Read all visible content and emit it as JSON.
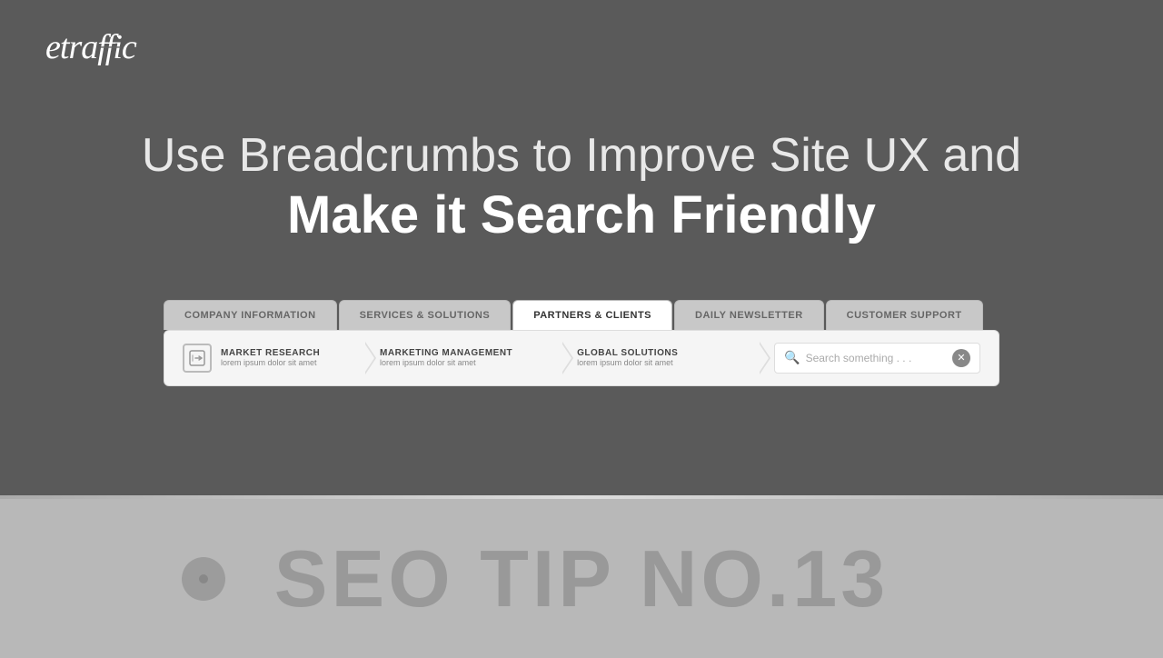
{
  "logo": {
    "text": "etraffic"
  },
  "hero": {
    "line1": "Use Breadcrumbs to Improve Site UX and",
    "line2": "Make it Search Friendly"
  },
  "nav": {
    "tabs": [
      {
        "id": "company-information",
        "label": "COMPANY INFORMATION",
        "active": false
      },
      {
        "id": "services-solutions",
        "label": "SERVICES & SOLUTIONS",
        "active": false
      },
      {
        "id": "partners-clients",
        "label": "PARTNERS & CLIENTS",
        "active": true
      },
      {
        "id": "daily-newsletter",
        "label": "DAILY NEWSLETTER",
        "active": false
      },
      {
        "id": "customer-support",
        "label": "CUSTOMER SUPPORT",
        "active": false
      }
    ]
  },
  "breadcrumbs": {
    "items": [
      {
        "id": "market-research",
        "title": "MARKET RESEARCH",
        "subtitle": "lorem ipsum dolor sit amet",
        "hasIcon": true
      },
      {
        "id": "marketing-management",
        "title": "MARKETING MANAGEMENT",
        "subtitle": "lorem ipsum dolor sit amet",
        "hasIcon": false
      },
      {
        "id": "global-solutions",
        "title": "GLOBAL SOLUTIONS",
        "subtitle": "lorem ipsum dolor sit amet",
        "hasIcon": false
      }
    ],
    "search": {
      "placeholder": "Search something . . ."
    }
  },
  "seo_tip": {
    "text": "SEO TIP NO.13"
  }
}
